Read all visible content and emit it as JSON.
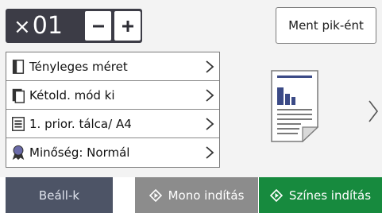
{
  "copies": {
    "prefix": "×",
    "value": "01"
  },
  "stepper": {
    "minus_icon": "minus-icon",
    "plus_icon": "plus-icon"
  },
  "save_shortcut": {
    "label": "Ment pik-ént"
  },
  "settings": [
    {
      "icon": "document-page-icon",
      "label": "Tényleges méret"
    },
    {
      "icon": "duplex-page-icon",
      "label": "Kétold. mód ki"
    },
    {
      "icon": "tray-list-icon",
      "label": "1. prior. tálca/ A4"
    },
    {
      "icon": "quality-ribbon-icon",
      "label": "Minőség: Normál"
    }
  ],
  "preview": {
    "thumbnail_icon": "document-preview-icon",
    "next_icon": "chevron-right-icon"
  },
  "bottom": {
    "settings_label": "Beáll-k",
    "mono_label": "Mono indítás",
    "color_label": "Színes indítás"
  },
  "colors": {
    "counter_bg": "#3c3c46",
    "settings_button": "#4d5466",
    "mono_button": "#8c8c8c",
    "color_button": "#178a3e"
  }
}
